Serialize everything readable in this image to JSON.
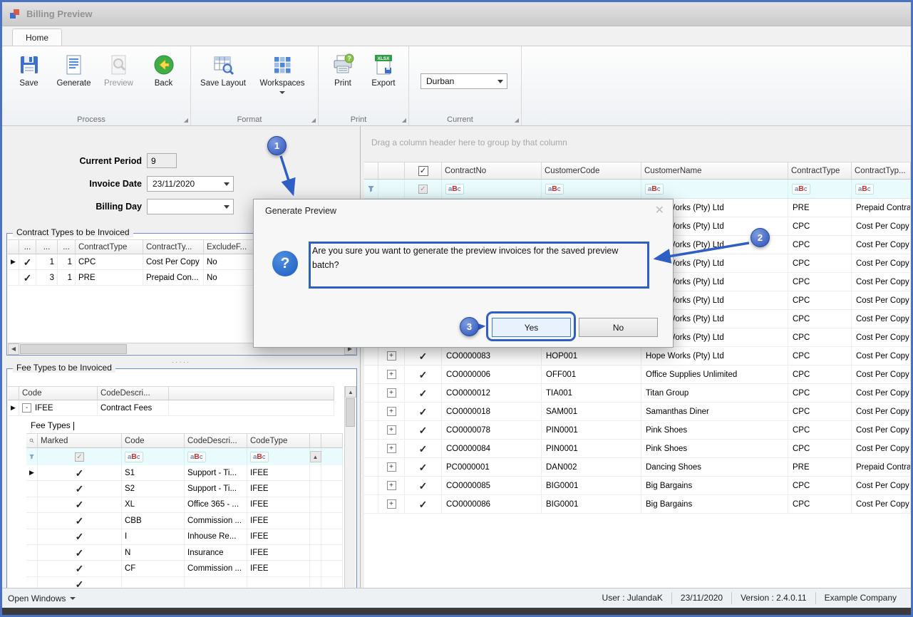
{
  "window": {
    "title": "Billing Preview"
  },
  "ribbon": {
    "home_tab": "Home",
    "process": {
      "caption": "Process",
      "save": "Save",
      "generate": "Generate",
      "preview": "Preview",
      "back": "Back"
    },
    "format": {
      "caption": "Format",
      "save_layout": "Save Layout",
      "workspaces": "Workspaces"
    },
    "print_group": {
      "caption": "Print",
      "print": "Print",
      "export": "Export",
      "export_badge": "XLSX"
    },
    "current": {
      "caption": "Current",
      "value": "Durban"
    }
  },
  "form": {
    "current_period_label": "Current Period",
    "current_period_value": "9",
    "invoice_date_label": "Invoice Date",
    "invoice_date_value": "23/11/2020",
    "billing_day_label": "Billing Day",
    "billing_day_value": ""
  },
  "contract_types": {
    "title": "Contract Types to be Invoiced",
    "columns": [
      "...",
      "...",
      "...",
      "ContractType",
      "ContractTy...",
      "ExcludeF..."
    ],
    "rows": [
      {
        "selected": true,
        "checked": true,
        "num1": "1",
        "num2": "1",
        "type": "CPC",
        "type_desc": "Cost Per Copy",
        "exclude": "No"
      },
      {
        "selected": false,
        "checked": true,
        "num1": "3",
        "num2": "1",
        "type": "PRE",
        "type_desc": "Prepaid Con...",
        "exclude": "No"
      }
    ]
  },
  "fee_types": {
    "title": "Fee Types to be Invoiced",
    "columns": [
      "Code",
      "CodeDescri..."
    ],
    "master_row": {
      "code": "IFEE",
      "description": "Contract Fees"
    },
    "detail": {
      "tab_label": "Fee Types",
      "columns": [
        "Marked",
        "Code",
        "CodeDescri...",
        "CodeType"
      ],
      "rows": [
        {
          "selected": true,
          "marked": true,
          "code": "S1",
          "description": "Support - Ti...",
          "code_type": "IFEE"
        },
        {
          "selected": false,
          "marked": true,
          "code": "S2",
          "description": "Support - Ti...",
          "code_type": "IFEE"
        },
        {
          "selected": false,
          "marked": true,
          "code": "XL",
          "description": "Office 365 - ...",
          "code_type": "IFEE"
        },
        {
          "selected": false,
          "marked": true,
          "code": "CBB",
          "description": "Commission ...",
          "code_type": "IFEE"
        },
        {
          "selected": false,
          "marked": true,
          "code": "I",
          "description": "Inhouse Re...",
          "code_type": "IFEE"
        },
        {
          "selected": false,
          "marked": true,
          "code": "N",
          "description": "Insurance",
          "code_type": "IFEE"
        },
        {
          "selected": false,
          "marked": true,
          "code": "CF",
          "description": "Commission ...",
          "code_type": "IFEE"
        },
        {
          "selected": false,
          "marked": true,
          "code": "",
          "description": "",
          "code_type": ""
        }
      ]
    }
  },
  "grid": {
    "group_hint": "Drag a column header here to group by that column",
    "columns": [
      "ContractNo",
      "CustomerCode",
      "CustomerName",
      "ContractType",
      "ContractTyp..."
    ],
    "rows": [
      {
        "contract_no": "",
        "customer_code": "",
        "customer_name": "Hope Works (Pty) Ltd",
        "contract_type": "PRE",
        "contract_type_desc": "Prepaid Contract"
      },
      {
        "contract_no": "",
        "customer_code": "",
        "customer_name": "Hope Works (Pty) Ltd",
        "contract_type": "CPC",
        "contract_type_desc": "Cost Per Copy"
      },
      {
        "contract_no": "",
        "customer_code": "",
        "customer_name": "Hope Works (Pty) Ltd",
        "contract_type": "CPC",
        "contract_type_desc": "Cost Per Copy"
      },
      {
        "contract_no": "",
        "customer_code": "",
        "customer_name": "Hope Works (Pty) Ltd",
        "contract_type": "CPC",
        "contract_type_desc": "Cost Per Copy"
      },
      {
        "contract_no": "",
        "customer_code": "",
        "customer_name": "Hope Works (Pty) Ltd",
        "contract_type": "CPC",
        "contract_type_desc": "Cost Per Copy"
      },
      {
        "contract_no": "",
        "customer_code": "",
        "customer_name": "Hope Works (Pty) Ltd",
        "contract_type": "CPC",
        "contract_type_desc": "Cost Per Copy"
      },
      {
        "contract_no": "",
        "customer_code": "",
        "customer_name": "Hope Works (Pty) Ltd",
        "contract_type": "CPC",
        "contract_type_desc": "Cost Per Copy"
      },
      {
        "contract_no": "",
        "customer_code": "",
        "customer_name": "Hope Works (Pty) Ltd",
        "contract_type": "CPC",
        "contract_type_desc": "Cost Per Copy"
      },
      {
        "contract_no": "CO0000083",
        "customer_code": "HOP001",
        "customer_name": "Hope Works (Pty) Ltd",
        "contract_type": "CPC",
        "contract_type_desc": "Cost Per Copy"
      },
      {
        "contract_no": "CO0000006",
        "customer_code": "OFF001",
        "customer_name": "Office Supplies Unlimited",
        "contract_type": "CPC",
        "contract_type_desc": "Cost Per Copy"
      },
      {
        "contract_no": "CO0000012",
        "customer_code": "TIA001",
        "customer_name": "Titan Group",
        "contract_type": "CPC",
        "contract_type_desc": "Cost Per Copy"
      },
      {
        "contract_no": "CO0000018",
        "customer_code": "SAM001",
        "customer_name": "Samanthas Diner",
        "contract_type": "CPC",
        "contract_type_desc": "Cost Per Copy"
      },
      {
        "contract_no": "CO0000078",
        "customer_code": "PIN0001",
        "customer_name": "Pink Shoes",
        "contract_type": "CPC",
        "contract_type_desc": "Cost Per Copy"
      },
      {
        "contract_no": "CO0000084",
        "customer_code": "PIN0001",
        "customer_name": "Pink Shoes",
        "contract_type": "CPC",
        "contract_type_desc": "Cost Per Copy"
      },
      {
        "contract_no": "PC0000001",
        "customer_code": "DAN002",
        "customer_name": "Dancing Shoes",
        "contract_type": "PRE",
        "contract_type_desc": "Prepaid Contract"
      },
      {
        "contract_no": "CO0000085",
        "customer_code": "BIG0001",
        "customer_name": "Big Bargains",
        "contract_type": "CPC",
        "contract_type_desc": "Cost Per Copy"
      },
      {
        "contract_no": "CO0000086",
        "customer_code": "BIG0001",
        "customer_name": "Big Bargains",
        "contract_type": "CPC",
        "contract_type_desc": "Cost Per Copy"
      }
    ]
  },
  "filter_badge": {
    "a": "a",
    "b": "B",
    "c": "c"
  },
  "dialog": {
    "title": "Generate Preview",
    "message": "Are you sure you want to generate the preview invoices for the saved preview batch?",
    "yes_label": "Yes",
    "no_label": "No"
  },
  "annotations": {
    "step1": "1",
    "step2": "2",
    "step3": "3"
  },
  "status_bar": {
    "open_windows": "Open Windows",
    "user": "User : JulandaK",
    "date": "23/11/2020",
    "version": "Version : 2.4.0.11",
    "company": "Example Company"
  }
}
